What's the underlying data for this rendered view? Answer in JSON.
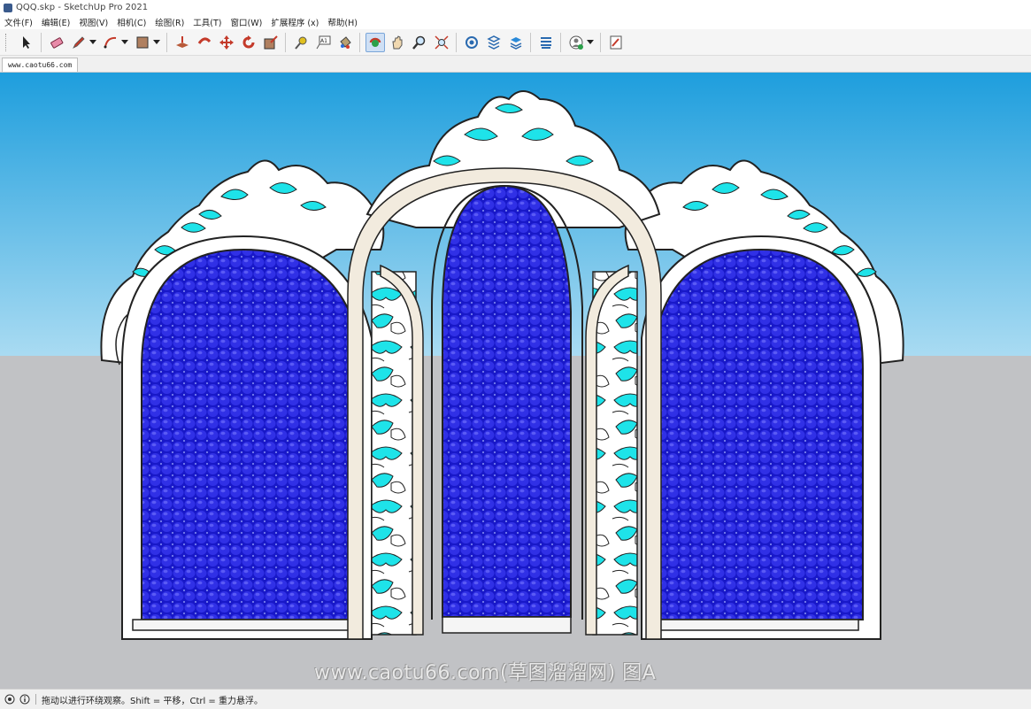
{
  "window": {
    "title": "QQQ.skp - SketchUp Pro 2021"
  },
  "menu": [
    "文件(F)",
    "编辑(E)",
    "视图(V)",
    "相机(C)",
    "绘图(R)",
    "工具(T)",
    "窗口(W)",
    "扩展程序 (x)",
    "帮助(H)"
  ],
  "tab": {
    "label": "www.caotu66.com"
  },
  "watermark": {
    "text": "www.caotu66.com(草图溜溜网) 图A"
  },
  "status": {
    "text": "拖动以进行环绕观察。Shift = 平移，Ctrl = 重力悬浮。"
  },
  "colors": {
    "sky_top": "#1e9edd",
    "ground": "#c1c2c5",
    "panel_blue": "#1c1ccc",
    "cyan": "#1ee3e9",
    "frame": "#f2ebde"
  }
}
